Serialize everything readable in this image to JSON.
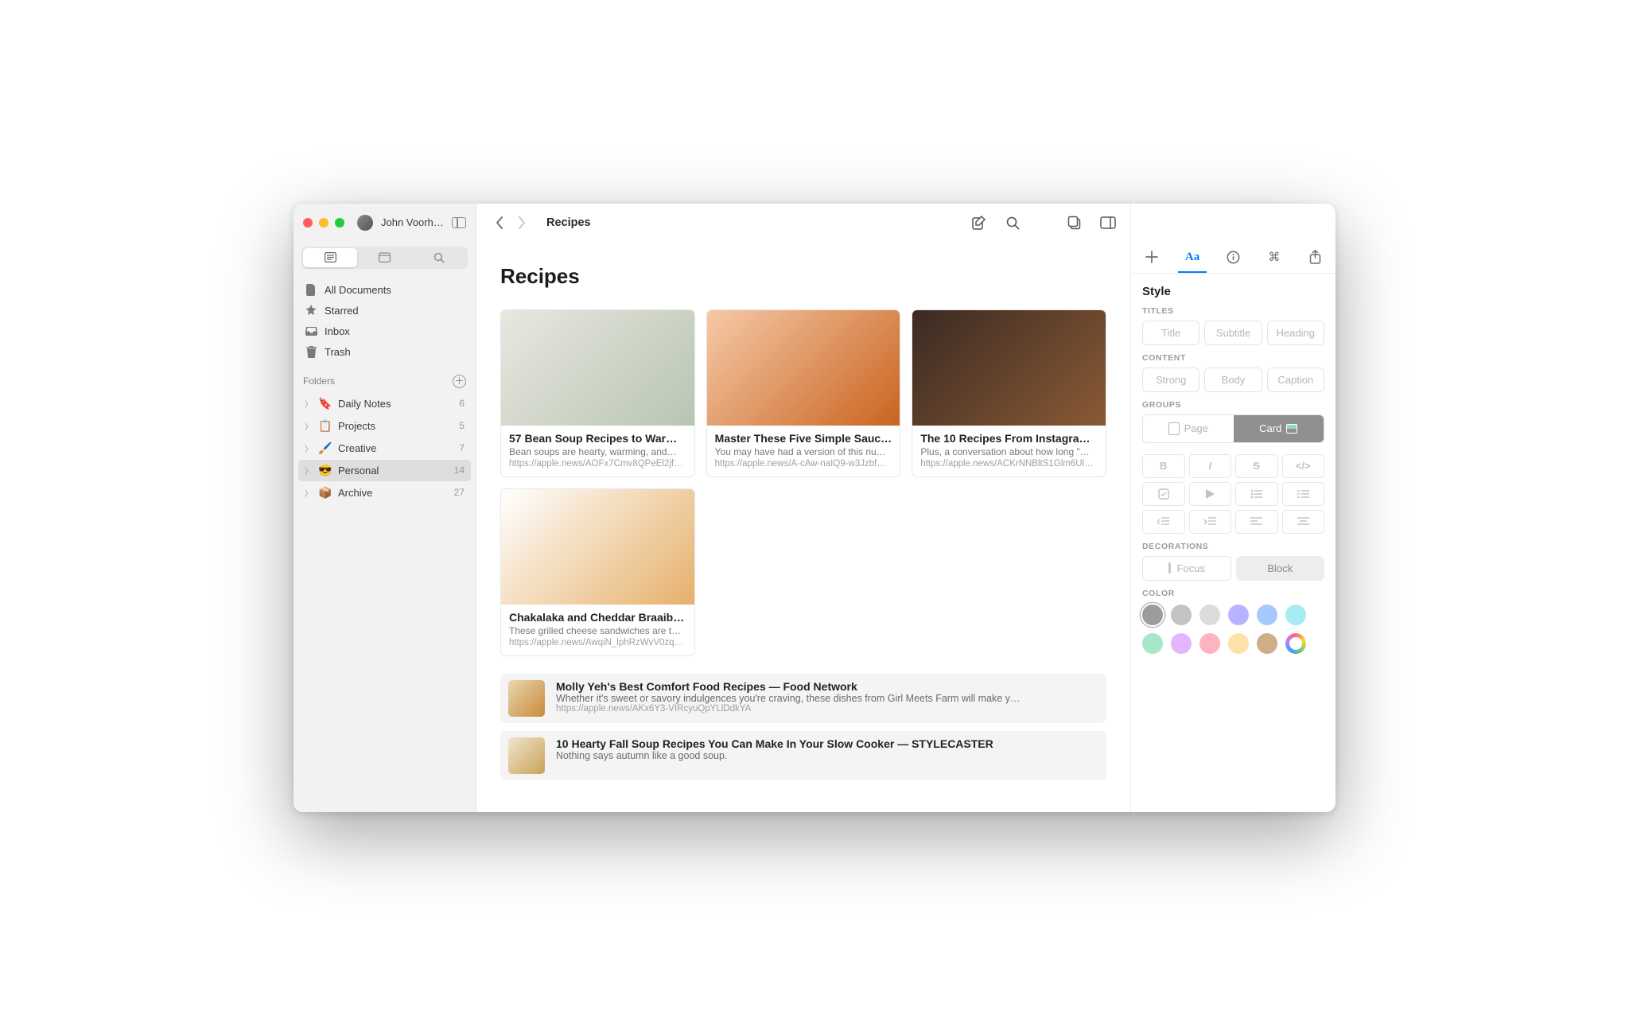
{
  "user": {
    "name": "John Voorhe…"
  },
  "breadcrumb": "Recipes",
  "sidebar": {
    "nav": [
      {
        "label": "All Documents"
      },
      {
        "label": "Starred"
      },
      {
        "label": "Inbox"
      },
      {
        "label": "Trash"
      }
    ],
    "folders_label": "Folders",
    "folders": [
      {
        "emoji": "🔖",
        "label": "Daily Notes",
        "count": "6"
      },
      {
        "emoji": "📋",
        "label": "Projects",
        "count": "5"
      },
      {
        "emoji": "🖌️",
        "label": "Creative",
        "count": "7"
      },
      {
        "emoji": "😎",
        "label": "Personal",
        "count": "14",
        "selected": true
      },
      {
        "emoji": "📦",
        "label": "Archive",
        "count": "27"
      }
    ]
  },
  "document": {
    "title": "Recipes",
    "cards": [
      {
        "title": "57 Bean Soup Recipes to Warm…",
        "desc": "Bean soups are hearty, warming, and…",
        "url": "https://apple.news/AOFx7Cmv8QPeEl2jfH…",
        "bg": "linear-gradient(135deg,#e9e7e0,#b8c5b2)"
      },
      {
        "title": "Master These Five Simple Sauc…",
        "desc": "You may have had a version of this nu…",
        "url": "https://apple.news/A-cAw-naIQ9-w3Jzbf…",
        "bg": "linear-gradient(135deg,#f6c9a8,#c9641f)"
      },
      {
        "title": "The 10 Recipes From Instagram…",
        "desc": "Plus, a conversation about how long \"…",
        "url": "https://apple.news/ACKrNNBltS1Glm6UlY…",
        "bg": "linear-gradient(135deg,#3a2a22,#8a5a34)"
      },
      {
        "title": "Chakalaka and Cheddar Braaibr…",
        "desc": "These grilled cheese sandwiches are t…",
        "url": "https://apple.news/AwqiN_lphRzWvV0zqx…",
        "bg": "linear-gradient(135deg,#fff,#e6b06a)"
      }
    ],
    "links": [
      {
        "title": "Molly Yeh's Best Comfort Food Recipes — Food Network",
        "desc": "Whether it's sweet or savory indulgences you're craving, these dishes from Girl Meets Farm will make y…",
        "url": "https://apple.news/AKx6Y3-VIRcyuQpYLlDdkYA",
        "bg": "linear-gradient(135deg,#e9d7b0,#c98a3a)"
      },
      {
        "title": "10 Hearty Fall Soup Recipes You Can Make In Your Slow Cooker — STYLECASTER",
        "desc": "Nothing says autumn like a good soup.",
        "url": "",
        "bg": "linear-gradient(135deg,#f1e6cc,#c9a15a)"
      }
    ]
  },
  "inspector": {
    "heading": "Style",
    "labels": {
      "titles": "TITLES",
      "content": "CONTENT",
      "groups": "GROUPS",
      "decorations": "DECORATIONS",
      "color": "COLOR"
    },
    "titles": [
      "Title",
      "Subtitle",
      "Heading"
    ],
    "content": [
      "Strong",
      "Body",
      "Caption"
    ],
    "groups": {
      "page": "Page",
      "card": "Card"
    },
    "decorations": {
      "focus": "Focus",
      "block": "Block"
    },
    "colors": [
      "#9c9c9c",
      "#c3c3c3",
      "#dcdcdc",
      "#b7b4ff",
      "#a7c8ff",
      "#a7ecf0",
      "#a7e7c8",
      "#e3b6ff",
      "#ffb3c0",
      "#ffe0a7",
      "#cfae87"
    ]
  }
}
